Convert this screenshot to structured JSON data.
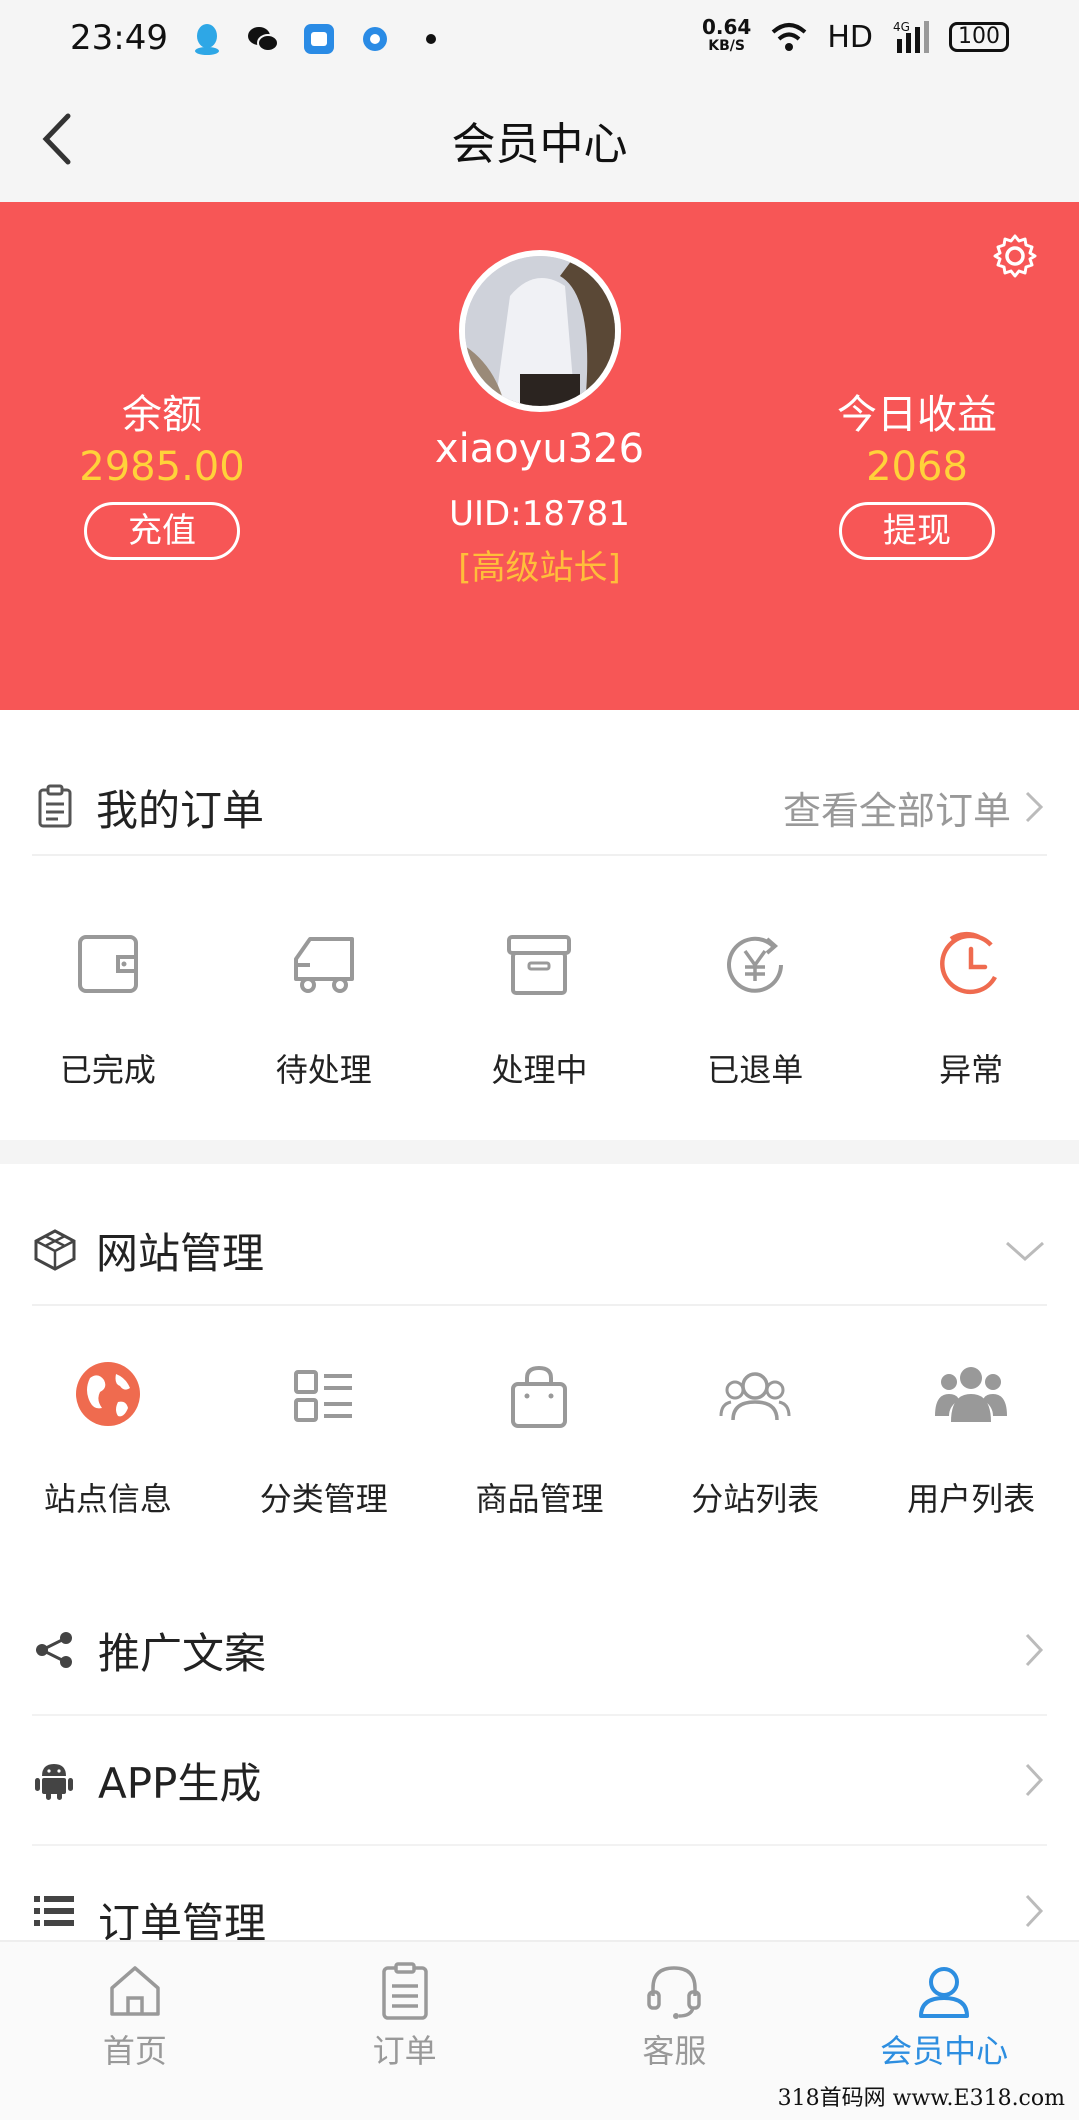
{
  "status_bar": {
    "time": "23:49",
    "speed_value": "0.64",
    "speed_unit": "KB/S",
    "network": "HD",
    "signal": "4G",
    "battery": "100",
    "icons": [
      "qq-icon",
      "wechat-icon",
      "app-icon",
      "browser-icon",
      "dot-icon",
      "wifi-icon",
      "signal-icon",
      "battery-icon"
    ]
  },
  "nav": {
    "title": "会员中心"
  },
  "profile": {
    "balance_label": "余额",
    "balance_value": "2985.00",
    "recharge_label": "充值",
    "username": "xiaoyu326",
    "uid": "UID:18781",
    "level": "[高级站长]",
    "income_label": "今日收益",
    "income_value": "2068",
    "withdraw_label": "提现"
  },
  "orders": {
    "title": "我的订单",
    "view_all": "查看全部订单",
    "items": [
      {
        "label": "已完成",
        "icon": "wallet-icon"
      },
      {
        "label": "待处理",
        "icon": "truck-icon"
      },
      {
        "label": "处理中",
        "icon": "archive-box-icon"
      },
      {
        "label": "已退单",
        "icon": "yen-refund-icon"
      },
      {
        "label": "异常",
        "icon": "clock-alert-icon"
      }
    ]
  },
  "site_manage": {
    "title": "网站管理",
    "items": [
      {
        "label": "站点信息",
        "icon": "globe-icon"
      },
      {
        "label": "分类管理",
        "icon": "category-list-icon"
      },
      {
        "label": "商品管理",
        "icon": "shopping-bag-icon"
      },
      {
        "label": "分站列表",
        "icon": "users-outline-icon"
      },
      {
        "label": "用户列表",
        "icon": "users-group-icon"
      }
    ]
  },
  "menu": [
    {
      "label": "推广文案",
      "icon": "share-icon"
    },
    {
      "label": "APP生成",
      "icon": "android-icon"
    },
    {
      "label": "订单管理",
      "icon": "list-icon"
    }
  ],
  "tabs": [
    {
      "label": "首页",
      "icon": "home-icon"
    },
    {
      "label": "订单",
      "icon": "clipboard-icon"
    },
    {
      "label": "客服",
      "icon": "headset-icon"
    },
    {
      "label": "会员中心",
      "icon": "user-icon"
    }
  ],
  "active_tab": "会员中心",
  "watermark": "318首码网 www.E318.com",
  "colors": {
    "header_red": "#f75656",
    "accent_yellow": "#ffd23a",
    "level_orange": "#ffbe3a",
    "tab_active": "#2d8ee0",
    "orange_icon": "#ef6b4f"
  }
}
